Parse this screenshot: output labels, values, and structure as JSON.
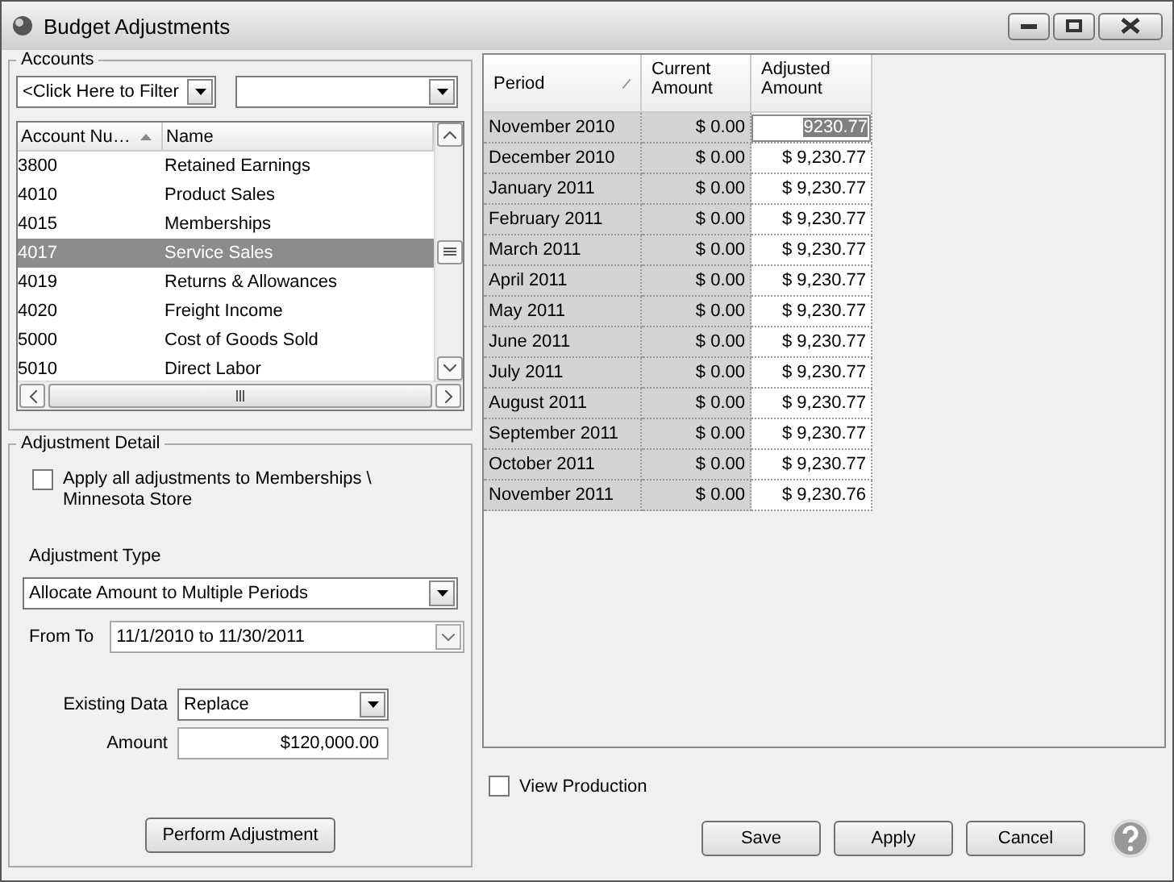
{
  "window": {
    "title": "Budget Adjustments"
  },
  "accounts": {
    "title": "Accounts",
    "filter_field": {
      "value": "<Click Here to Filter"
    },
    "columns": [
      {
        "label": "Account Nu…",
        "sorted": true
      },
      {
        "label": "Name",
        "sorted": false
      }
    ],
    "rows": [
      {
        "number": "3800",
        "name": "Retained Earnings",
        "selected": false
      },
      {
        "number": "4010",
        "name": "Product Sales",
        "selected": false
      },
      {
        "number": "4015",
        "name": "Memberships",
        "selected": false
      },
      {
        "number": "4017",
        "name": "Service Sales",
        "selected": true
      },
      {
        "number": "4019",
        "name": "Returns & Allowances",
        "selected": false
      },
      {
        "number": "4020",
        "name": "Freight Income",
        "selected": false
      },
      {
        "number": "5000",
        "name": "Cost of Goods Sold",
        "selected": false
      },
      {
        "number": "5010",
        "name": "Direct Labor",
        "selected": false
      }
    ]
  },
  "detail": {
    "title": "Adjustment Detail",
    "apply_all": {
      "label": "Apply all adjustments to Memberships \\ Minnesota Store",
      "checked": false
    },
    "adjustment_type": {
      "label": "Adjustment Type",
      "value": "Allocate Amount to Multiple Periods"
    },
    "from_to": {
      "label": "From To",
      "value": "11/1/2010 to 11/30/2011"
    },
    "existing_data": {
      "label": "Existing Data",
      "value": "Replace"
    },
    "amount": {
      "label": "Amount",
      "value": "$120,000.00"
    },
    "button": "Perform Adjustment"
  },
  "periods": {
    "columns": [
      {
        "label": "Period",
        "sorted": true
      },
      {
        "label": "Current Amount",
        "sorted": false
      },
      {
        "label": "Adjusted Amount",
        "sorted": false
      }
    ],
    "rows": [
      {
        "period": "November 2010",
        "current": "$ 0.00",
        "adjusted": "9230.77",
        "editing": true
      },
      {
        "period": "December 2010",
        "current": "$ 0.00",
        "adjusted": "$ 9,230.77",
        "editing": false
      },
      {
        "period": "January 2011",
        "current": "$ 0.00",
        "adjusted": "$ 9,230.77",
        "editing": false
      },
      {
        "period": "February 2011",
        "current": "$ 0.00",
        "adjusted": "$ 9,230.77",
        "editing": false
      },
      {
        "period": "March 2011",
        "current": "$ 0.00",
        "adjusted": "$ 9,230.77",
        "editing": false
      },
      {
        "period": "April 2011",
        "current": "$ 0.00",
        "adjusted": "$ 9,230.77",
        "editing": false
      },
      {
        "period": "May 2011",
        "current": "$ 0.00",
        "adjusted": "$ 9,230.77",
        "editing": false
      },
      {
        "period": "June 2011",
        "current": "$ 0.00",
        "adjusted": "$ 9,230.77",
        "editing": false
      },
      {
        "period": "July 2011",
        "current": "$ 0.00",
        "adjusted": "$ 9,230.77",
        "editing": false
      },
      {
        "period": "August 2011",
        "current": "$ 0.00",
        "adjusted": "$ 9,230.77",
        "editing": false
      },
      {
        "period": "September 2011",
        "current": "$ 0.00",
        "adjusted": "$ 9,230.77",
        "editing": false
      },
      {
        "period": "October 2011",
        "current": "$ 0.00",
        "adjusted": "$ 9,230.77",
        "editing": false
      },
      {
        "period": "November 2011",
        "current": "$ 0.00",
        "adjusted": "$ 9,230.76",
        "editing": false
      }
    ]
  },
  "view_production": {
    "label": "View Production",
    "checked": false
  },
  "buttons": [
    "Save",
    "Apply",
    "Cancel"
  ]
}
